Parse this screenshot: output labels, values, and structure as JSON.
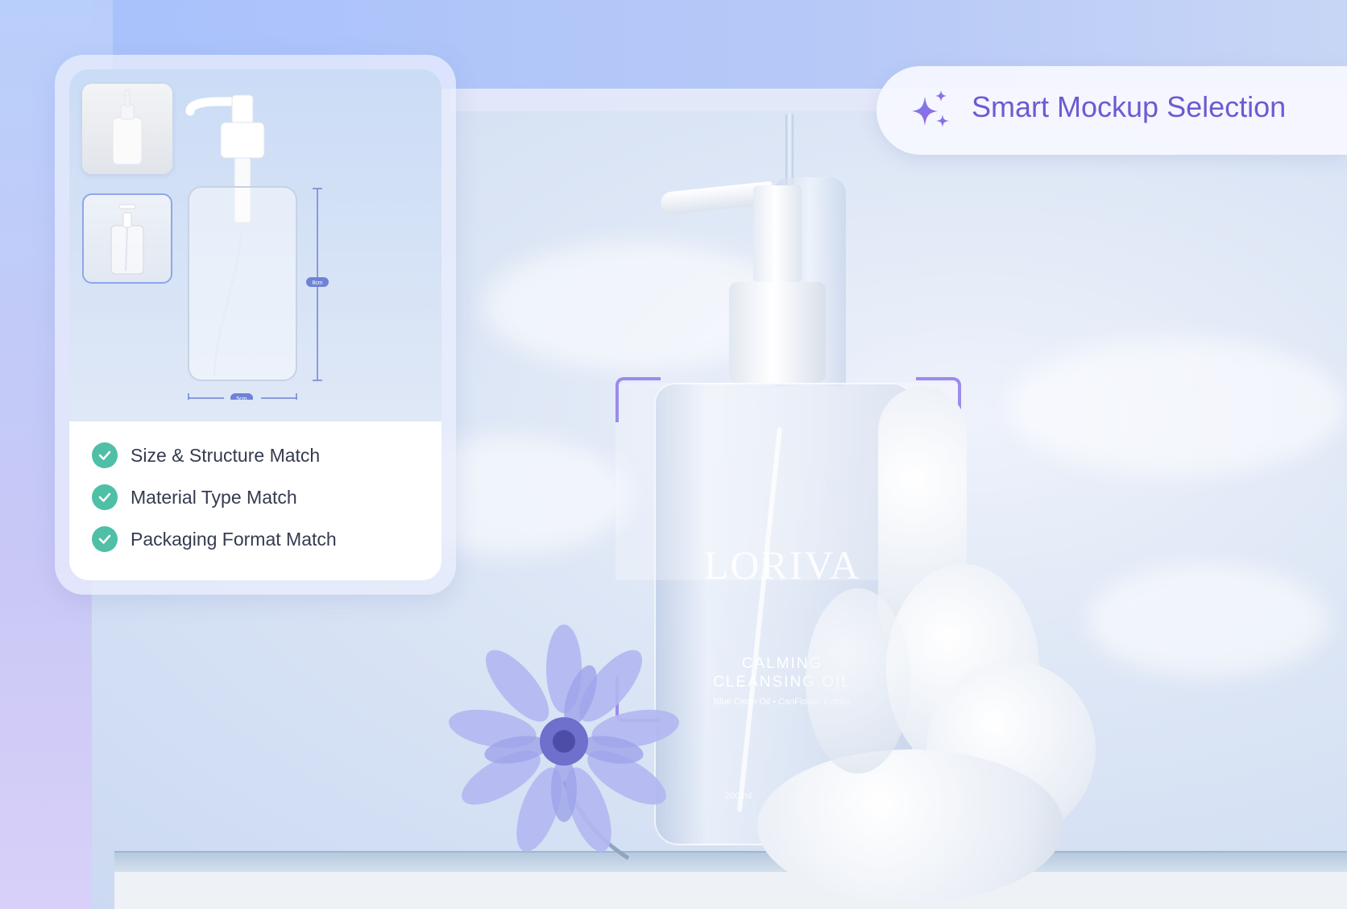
{
  "badge": {
    "icon": "sparkle-icon",
    "text": "Smart Mockup Selection",
    "text_color": "#6b5bd2"
  },
  "card": {
    "thumbnails": [
      {
        "name": "white-bottle-thumbnail",
        "selected": false
      },
      {
        "name": "clear-pump-bottle-thumbnail",
        "selected": true
      }
    ],
    "dimensions": {
      "height_label": "8cm",
      "width_label": "5cm"
    },
    "checks": [
      {
        "icon": "check-icon",
        "label": "Size & Structure Match"
      },
      {
        "icon": "check-icon",
        "label": "Material Type Match"
      },
      {
        "icon": "check-icon",
        "label": "Packaging Format Match"
      }
    ],
    "check_color": "#4fbfa6"
  },
  "product": {
    "brand": "LORIVA",
    "name_line1": "CALMING",
    "name_line2": "CLEANSING OIL",
    "subtitle": "Blue Clean Oil • CanFlower Extract",
    "volume": "200 ml",
    "selection_frame_color": "#9c8bec"
  }
}
